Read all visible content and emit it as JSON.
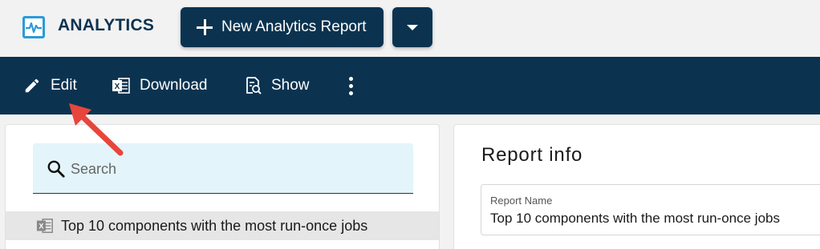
{
  "header": {
    "brand_icon": "analytics-monitor-icon",
    "title": "ANALYTICS",
    "new_report_label": "New Analytics Report",
    "dropdown_icon": "chevron-down-icon"
  },
  "toolbar": {
    "edit_label": "Edit",
    "download_label": "Download",
    "show_label": "Show",
    "more_icon": "more-vertical-icon"
  },
  "search": {
    "placeholder": "Search",
    "value": ""
  },
  "reports": [
    {
      "label": "Top 10 components with the most run-once jobs",
      "icon": "excel-file-icon"
    }
  ],
  "report_info": {
    "title": "Report info",
    "name_label": "Report Name",
    "name_value": "Top 10 components with the most run-once jobs"
  },
  "colors": {
    "primary": "#0b3350",
    "accent": "#2b9bd6",
    "search_bg": "#e3f4fb",
    "annotation_arrow": "#e8453c"
  }
}
